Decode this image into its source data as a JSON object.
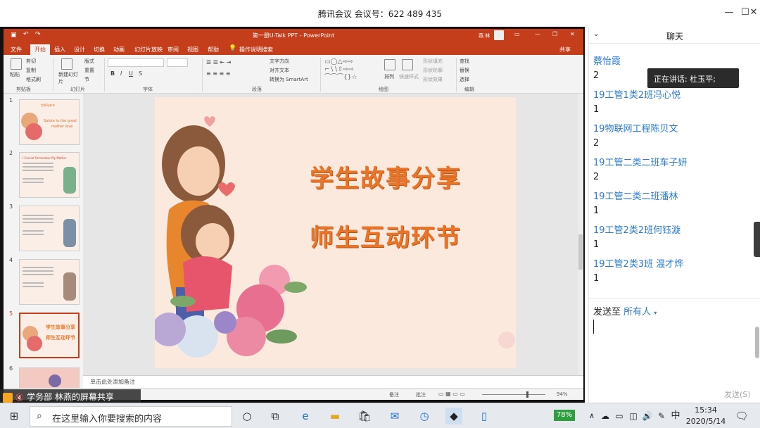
{
  "window": {
    "title": "腾讯会议 会议号：622 489 435"
  },
  "ppt": {
    "title": "第一册U-Talk PPT  -  PowerPoint",
    "user": "燕 林",
    "share_label": "共享",
    "tabs": [
      "文件",
      "开始",
      "插入",
      "设计",
      "切换",
      "动画",
      "幻灯片放映",
      "审阅",
      "视图",
      "帮助"
    ],
    "search_hint": "操作说明搜索",
    "ribbon": {
      "groups": [
        "剪贴板",
        "幻灯片",
        "字体",
        "段落",
        "绘图",
        "编辑"
      ],
      "paste": "粘贴",
      "cut": "剪切",
      "copy": "复制",
      "format_painter": "格式刷",
      "new_slide": "新建幻灯片",
      "layout": "版式",
      "reset": "重置",
      "section": "节",
      "text_direction": "文字方向",
      "align_text": "对齐文本",
      "smartart": "转换为 SmartArt",
      "arrange": "排列",
      "quick_styles": "快速样式",
      "shape_fill": "形状填充",
      "shape_outline": "形状轮廓",
      "shape_effects": "形状效果",
      "find": "查找",
      "replace": "替换",
      "select": "选择"
    },
    "thumbnails": [
      {
        "num": "1",
        "line1": "Salute to the great",
        "line2": "mother love",
        "top": "世界母亲节"
      },
      {
        "num": "2",
        "line1": "I Cannot Remember My Mother",
        "line2": ""
      },
      {
        "num": "3",
        "line1": "",
        "line2": ""
      },
      {
        "num": "4",
        "line1": "",
        "line2": ""
      },
      {
        "num": "5",
        "line1": "学生故事分享",
        "line2": "师生互动环节"
      },
      {
        "num": "6",
        "line1": "",
        "line2": ""
      }
    ],
    "slide": {
      "line1": "学生故事分享",
      "line2": "师生互动环节"
    },
    "notes_placeholder": "单击此处添加备注",
    "status": {
      "notes": "备注",
      "comments": "批注",
      "zoom": "94%"
    }
  },
  "sharer": "学务部 林燕的屏幕共享",
  "chat": {
    "title": "聊天",
    "speaking": "正在讲话: 杜玉平;",
    "messages": [
      {
        "type": "name",
        "text": "蔡怡霞"
      },
      {
        "type": "txt",
        "text": "2"
      },
      {
        "type": "name",
        "text": "19工管1类2班冯心悦"
      },
      {
        "type": "txt",
        "text": "1"
      },
      {
        "type": "name",
        "text": "19物联网工程陈贝文"
      },
      {
        "type": "txt",
        "text": "2"
      },
      {
        "type": "name",
        "text": "19工管二类二班车子妍"
      },
      {
        "type": "txt",
        "text": "2"
      },
      {
        "type": "name",
        "text": "19工管二类二班潘林"
      },
      {
        "type": "txt",
        "text": "1"
      },
      {
        "type": "name",
        "text": "19工管2类2班何钰漩"
      },
      {
        "type": "txt",
        "text": "1"
      },
      {
        "type": "name",
        "text": "19工管2类3班 温才烨"
      },
      {
        "type": "txt",
        "text": "1"
      }
    ],
    "send_to_label": "发送至",
    "send_to_target": "所有人",
    "send_button": "发送(S)"
  },
  "taskbar": {
    "search_placeholder": "在这里输入你要搜索的内容",
    "battery": "78%",
    "ime": "中",
    "time": "15:34",
    "date": "2020/5/14"
  },
  "colors": {
    "ppt_accent": "#c43e1c",
    "chat_name": "#2a7bd5",
    "slide_text": "#e8762a"
  }
}
